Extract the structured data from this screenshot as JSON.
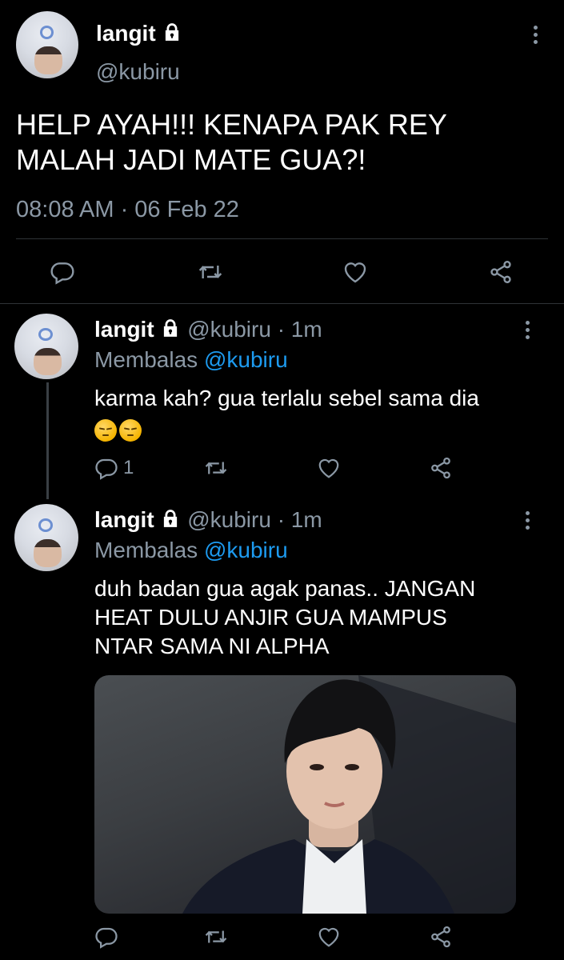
{
  "main_tweet": {
    "display_name": "langit",
    "handle": "@kubiru",
    "text_line1": "HELP AYAH!!! KENAPA PAK REY",
    "text_line2": "MALAH JADI MATE GUA?!",
    "timestamp": "08:08 AM · 06 Feb 22"
  },
  "replies": [
    {
      "display_name": "langit",
      "handle": "@kubiru",
      "time": "· 1m",
      "replying_label": "Membalas",
      "replying_to": "@kubiru",
      "text_line1": "karma kah? gua terlalu sebel sama dia",
      "reply_count": "1"
    },
    {
      "display_name": "langit",
      "handle": "@kubiru",
      "time": "· 1m",
      "replying_label": "Membalas",
      "replying_to": "@kubiru",
      "text_line1": "duh badan gua agak panas.. JANGAN",
      "text_line2": "HEAT DULU ANJIR GUA MAMPUS",
      "text_line3": "NTAR SAMA NI ALPHA"
    }
  ],
  "icons": {
    "reply": "reply-icon",
    "retweet": "retweet-icon",
    "like": "heart-icon",
    "share": "share-icon",
    "more": "more-vertical-icon",
    "lock": "lock-icon",
    "emoji": "pensive-face-emoji"
  },
  "colors": {
    "background": "#000000",
    "secondary_text": "#8b98a5",
    "link": "#1d9bf0",
    "divider": "#2f3336"
  }
}
